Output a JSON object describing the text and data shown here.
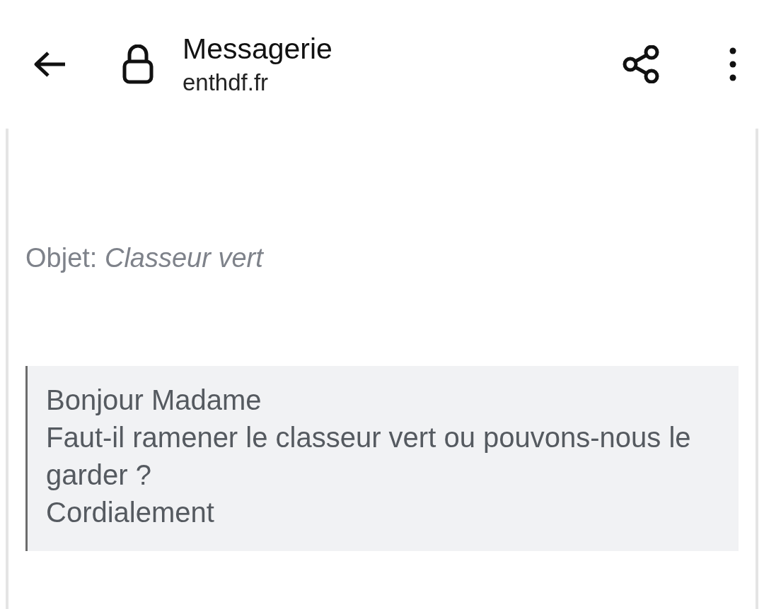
{
  "toolbar": {
    "title": "Messagerie",
    "url": "enthdf.fr"
  },
  "message": {
    "subject": "Objet: *Classeur vert*",
    "body": [
      "Bonjour Madame",
      "Faut-il ramener le classeur vert ou pouvons-nous le garder ?",
      "Cordialement"
    ]
  }
}
